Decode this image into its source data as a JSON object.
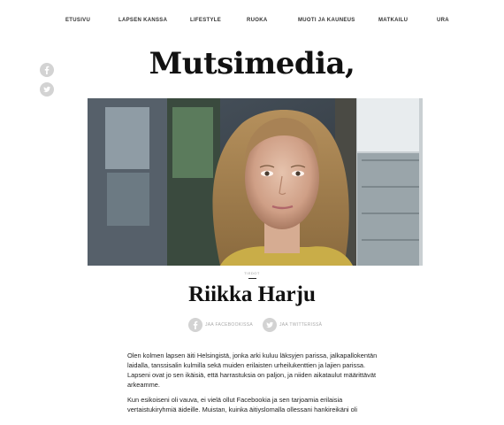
{
  "nav": {
    "items": [
      {
        "label": "ETUSIVU"
      },
      {
        "label": "LAPSEN KANSSA"
      },
      {
        "label": "LIFESTYLE"
      },
      {
        "label": "RUOKA"
      },
      {
        "label": "MUOTI JA KAUNEUS"
      },
      {
        "label": "MATKAILU"
      },
      {
        "label": "URA"
      }
    ]
  },
  "social_side": {
    "facebook_icon": "facebook-icon",
    "twitter_icon": "twitter-icon"
  },
  "logo": {
    "text": "Mutsimedia,"
  },
  "post": {
    "category": "TIEDOT",
    "author": "Riikka Harju",
    "share_facebook": "JAA FACEBOOKISSA",
    "share_twitter": "JAA TWITTERISSÄ"
  },
  "article": {
    "paragraphs": [
      "Olen kolmen lapsen äiti Helsingistä, jonka arki kuluu läksyjen parissa, jalkapallokentän laidalla, tanssisalin kulmilla sekä muiden erilaisten urheilukenttien ja lajien parissa. Lapseni ovat jo sen ikäisiä, että harrastuksia on paljon, ja niiden aikataulut määrittävät arkeamme.",
      "Kun esikoiseni oli vauva, ei vielä ollut Facebookia ja sen tarjoamia erilaisia vertaistukiryhmiä äideille. Muistan, kuinka äitiyslomalla ollessani hankireikäni oli"
    ]
  },
  "colors": {
    "icon_grey": "#d3d3d3",
    "text": "#222222"
  }
}
